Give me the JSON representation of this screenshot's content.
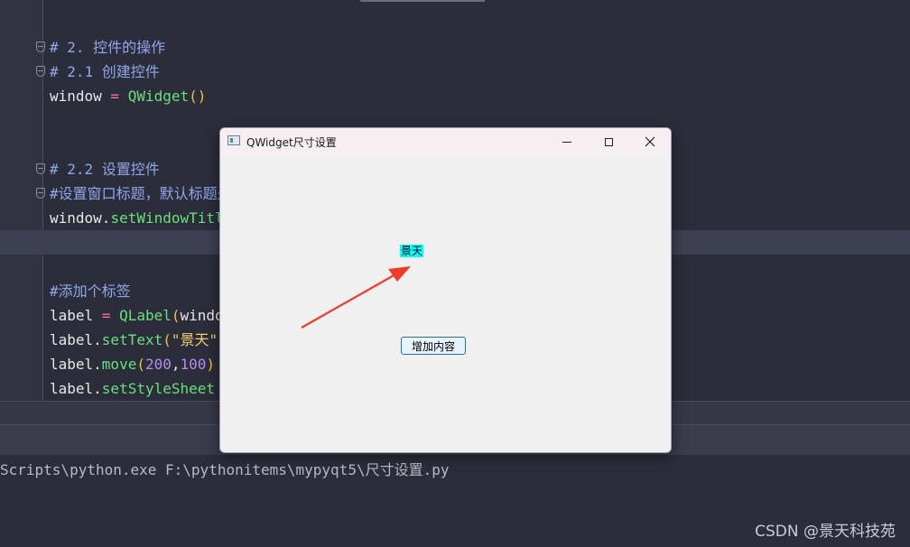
{
  "editor": {
    "lines": [
      {
        "comment": "# 2. 控件的操作"
      },
      {
        "comment": "# 2.1 创建控件"
      },
      {
        "var": "window",
        "op": " = ",
        "fn": "QWidget",
        "paren": "()"
      },
      {
        "comment": "# 2.2 设置控件"
      },
      {
        "comment": "#设置窗口标题，默认标题是"
      },
      {
        "var": "window.",
        "fn": "setWindowTitle"
      },
      {
        "comment": "#添加个标签"
      },
      {
        "var": "label",
        "op": " = ",
        "fn": "QLabel",
        "paren": "(",
        "rest": "windo"
      },
      {
        "var": "label.",
        "fn": "setText",
        "paren": "(",
        "str": "\"景天\""
      },
      {
        "var": "label.",
        "fn": "move",
        "paren": "(",
        "num1": "200",
        "comma": ",",
        "num2": "100",
        "paren2": ")"
      },
      {
        "var": "label.",
        "fn": "setStyleSheet"
      }
    ]
  },
  "console": {
    "command": "Scripts\\python.exe F:\\pythonitems\\mypyqt5\\尺寸设置.py"
  },
  "watermark": "CSDN @景天科技苑",
  "qt_window": {
    "title": "QWidget尺寸设置",
    "label_text": "景天",
    "button_label": "增加内容",
    "label_bg": "#00ffff"
  },
  "colors": {
    "editor_bg": "#2b2d3a",
    "arrow": "#f03a2a"
  },
  "icons": [
    "app-icon",
    "minimize-icon",
    "maximize-icon",
    "close-icon",
    "fold-icon",
    "arrow-annotation"
  ]
}
